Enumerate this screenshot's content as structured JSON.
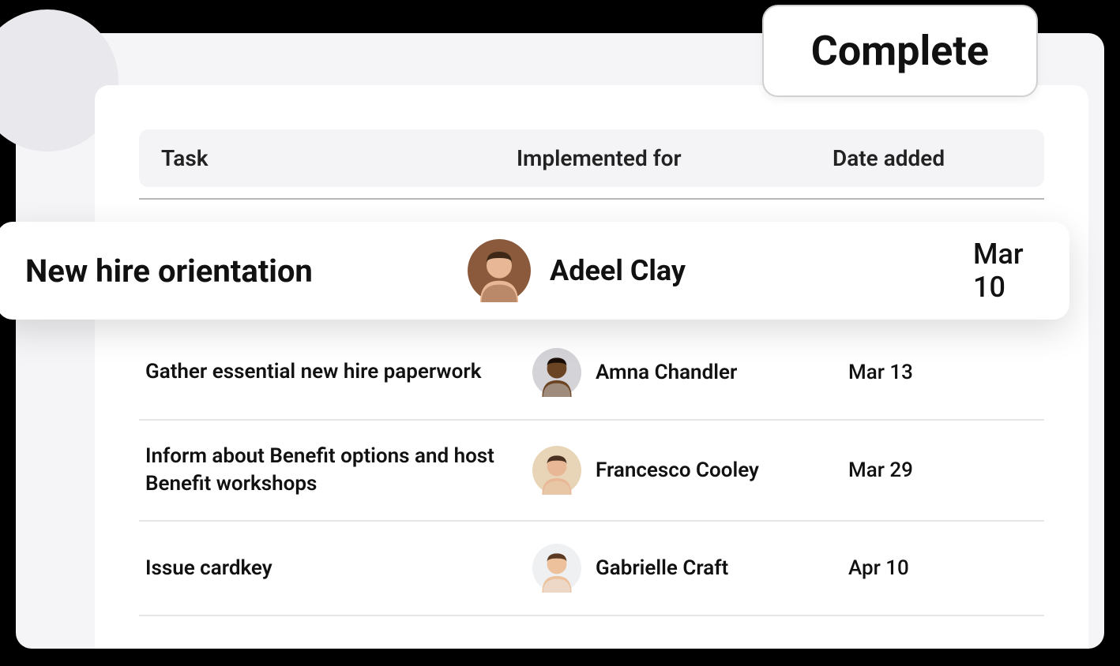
{
  "tab_label": "Complete",
  "columns": {
    "task": "Task",
    "implemented_for": "Implemented for",
    "date_added": "Date added"
  },
  "highlighted_task": {
    "task": "New hire orientation",
    "person": "Adeel Clay",
    "date": "Mar 10",
    "avatar_colors": {
      "bg": "#8b5a3c",
      "face": "#e8b896",
      "hair": "#3d2817"
    }
  },
  "tasks": [
    {
      "task": "Gather essential new hire paperwork",
      "person": "Amna Chandler",
      "date": "Mar 13",
      "avatar_colors": {
        "bg": "#d4d4d8",
        "face": "#6b4423",
        "hair": "#1a0f08"
      }
    },
    {
      "task": "Inform about Benefit options and host Benefit workshops",
      "person": "Francesco Cooley",
      "date": "Mar 29",
      "avatar_colors": {
        "bg": "#e8d5b7",
        "face": "#e8b896",
        "hair": "#4a3020"
      }
    },
    {
      "task": "Issue cardkey",
      "person": "Gabrielle Craft",
      "date": "Apr 10",
      "avatar_colors": {
        "bg": "#eef0f2",
        "face": "#ecc19c",
        "hair": "#5c3a22"
      }
    }
  ]
}
